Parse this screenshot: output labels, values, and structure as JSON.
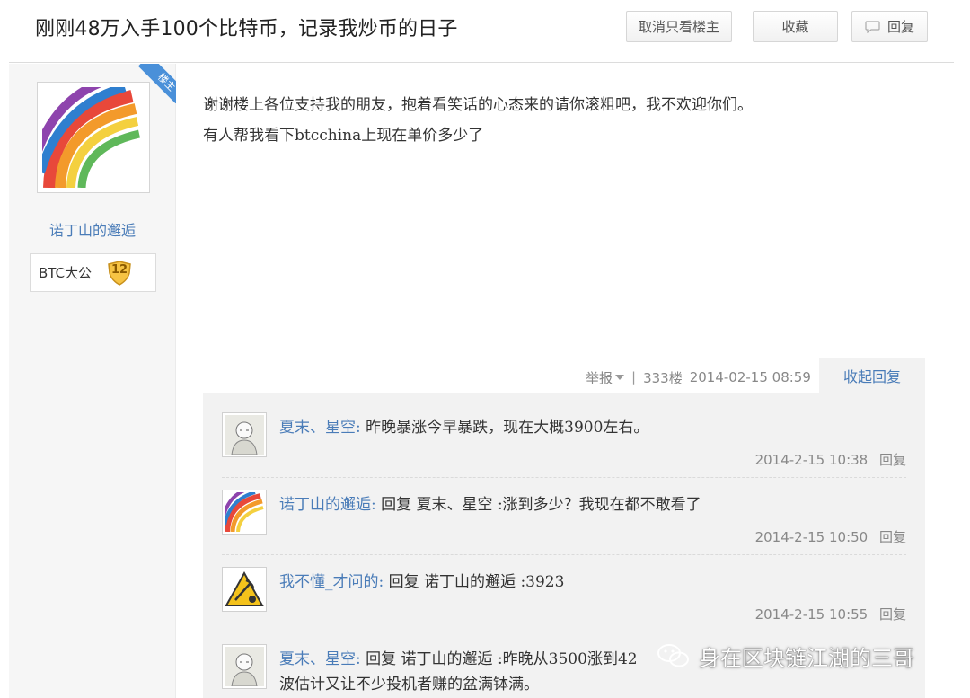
{
  "thread": {
    "title": "刚刚48万入手100个比特币，记录我炒币的日子",
    "buttons": {
      "cancel_only_op": "取消只看楼主",
      "favorite": "收藏",
      "reply": "回复"
    }
  },
  "author": {
    "corner_badge": "楼主",
    "name": "诺丁山的邂逅",
    "title_badge": "BTC大公",
    "level": "12",
    "avatar_icon": "rainbow-swirl-avatar"
  },
  "post": {
    "lines": [
      "谢谢楼上各位支持我的朋友，抱着看笑话的心态来的请你滚粗吧，我不欢迎你们。",
      "有人帮我看下btcchina上现在单价多少了"
    ],
    "report": "举报",
    "separator": "|",
    "floor": "333楼",
    "datetime": "2014-02-15 08:59",
    "collapse_replies": "收起回复"
  },
  "replies": [
    {
      "user": "夏末、星空:",
      "text": "昨晚暴涨今早暴跌，现在大概3900左右。",
      "text_line2": "",
      "time": "2014-2-15 10:38",
      "reply_label": "回复",
      "avatar_icon": "sketch-face-avatar"
    },
    {
      "user": "诺丁山的邂逅:",
      "text": "回复 夏末、星空 :涨到多少？我现在都不敢看了",
      "text_line2": "",
      "time": "2014-2-15 10:50",
      "reply_label": "回复",
      "avatar_icon": "rainbow-swirl-avatar"
    },
    {
      "user": "我不懂_才问的:",
      "text": "回复 诺丁山的邂逅 :3923",
      "text_line2": "",
      "time": "2014-2-15 10:55",
      "reply_label": "回复",
      "avatar_icon": "warning-miner-avatar"
    },
    {
      "user": "夏末、星空:",
      "text": "回复 诺丁山的邂逅 :昨晚从3500涨到42",
      "text_line2": "波估计又让不少投机者赚的盆满钵满。",
      "time": "",
      "reply_label": "",
      "avatar_icon": "sketch-face-avatar"
    }
  ],
  "watermark": {
    "text": "身在区块链江湖的三哥",
    "icon": "wechat-icon"
  },
  "colors": {
    "link_blue": "#4a7cb8",
    "badge_blue": "#4a90d9",
    "meta_gray": "#888888",
    "reply_bg": "#f2f2f2"
  }
}
